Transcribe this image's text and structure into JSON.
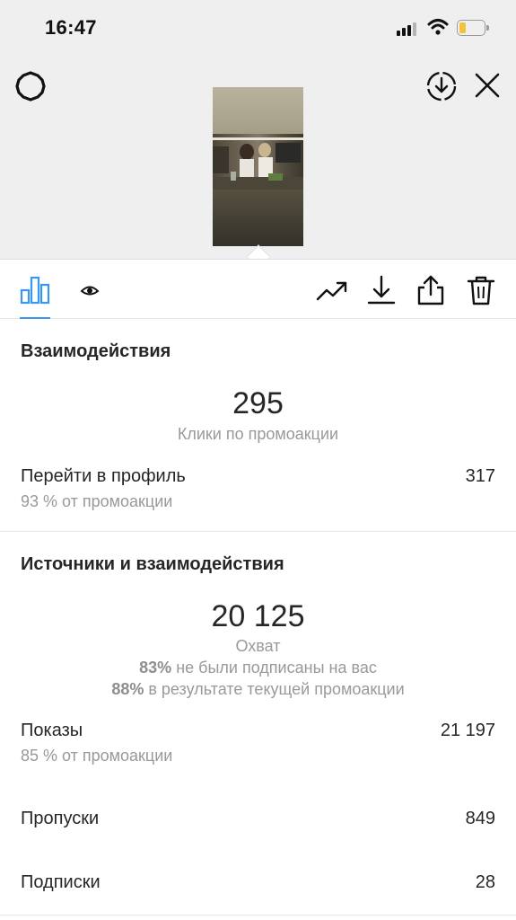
{
  "status_bar": {
    "time": "16:47"
  },
  "icons": {
    "settings": "settings-icon",
    "save_story": "save-story-icon",
    "close": "close-icon",
    "insights_tab": "bar-chart-icon",
    "viewers_tab": "eye-icon",
    "promote": "trending-up-icon",
    "download": "download-icon",
    "share": "share-icon",
    "delete": "trash-icon"
  },
  "colors": {
    "accent": "#3897f0",
    "battery": "#f2c23c",
    "muted_text": "#999999"
  },
  "interactions": {
    "title": "Взаимодействия",
    "clicks_value": "295",
    "clicks_label": "Клики по промоакции",
    "profile_label": "Перейти в профиль",
    "profile_sub": "93 % от промоакции",
    "profile_value": "317"
  },
  "discovery": {
    "title": "Источники и взаимодействия",
    "reach_value": "20 125",
    "reach_label": "Охват",
    "not_following_pct": "83%",
    "not_following_text": " не были подписаны на вас",
    "from_promo_pct": "88%",
    "from_promo_text": " в результате текущей промоакции",
    "impressions_label": "Показы",
    "impressions_sub": "85 % от промоакции",
    "impressions_value": "21 197",
    "skips_label": "Пропуски",
    "skips_value": "849",
    "follows_label": "Подписки",
    "follows_value": "28"
  }
}
